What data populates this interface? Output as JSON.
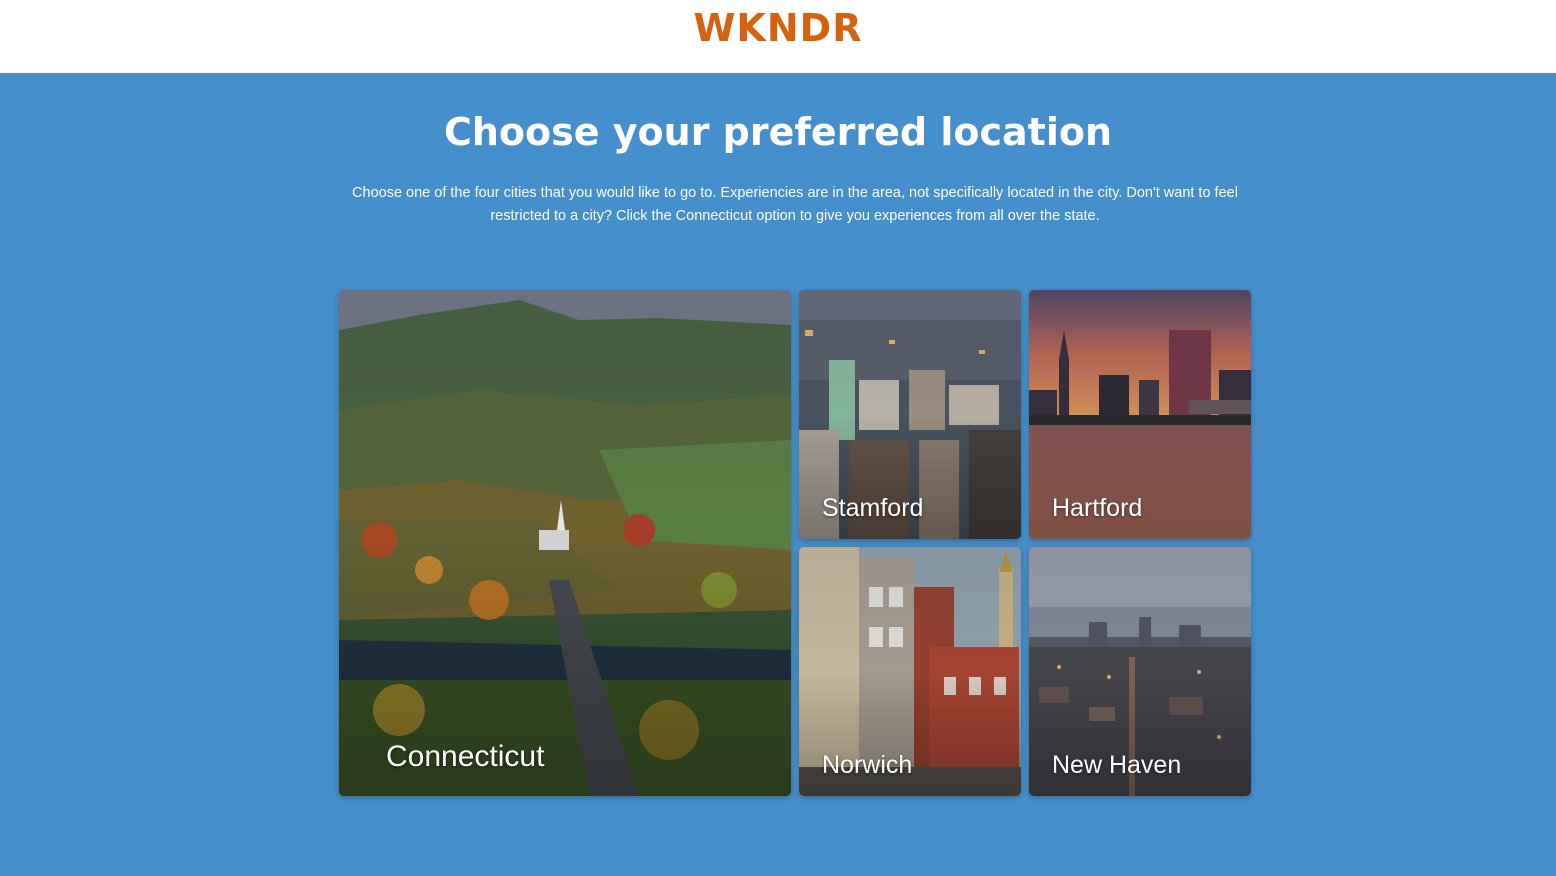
{
  "header": {
    "logo": "WKNDR",
    "logo_color": "#d5620f"
  },
  "main": {
    "title": "Choose your preferred location",
    "intro": "Choose one of the four cities that you would like to go to. Experiencies are in the area, not specifically located in the city. Don't want to feel restricted to a city? Click the Connecticut option to give you experiences from all over the state."
  },
  "locations": [
    {
      "label": "Connecticut",
      "image": "autumn-valley-aerial"
    },
    {
      "label": "Stamford",
      "image": "city-aerial"
    },
    {
      "label": "Hartford",
      "image": "skyline-sunset-river"
    },
    {
      "label": "Norwich",
      "image": "historic-street"
    },
    {
      "label": "New Haven",
      "image": "city-dusk-aerial"
    }
  ],
  "colors": {
    "background": "#458fcc",
    "header_bg": "#ffffff",
    "text": "#ffffff"
  }
}
